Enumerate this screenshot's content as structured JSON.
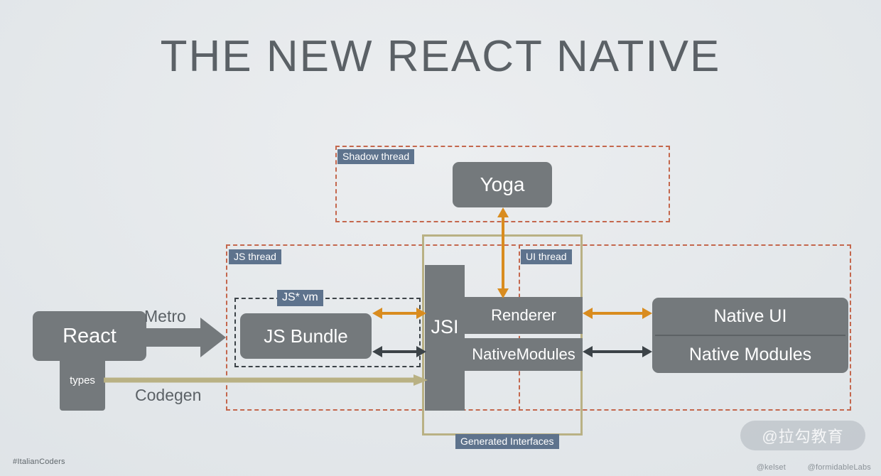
{
  "slide": {
    "title": "THE NEW REACT NATIVE",
    "background_color": "#e4e8eb",
    "node_color": "#74797c",
    "chip_color": "#5e738d",
    "region_color": "#c4674d",
    "olive_color": "#b9b184",
    "orange_arrow_color": "#d98c1f",
    "dark_arrow_color": "#3c4348"
  },
  "regions": [
    {
      "name": "shadow-thread",
      "label": "Shadow thread"
    },
    {
      "name": "js-thread",
      "label": "JS thread"
    },
    {
      "name": "ui-thread",
      "label": "UI thread"
    },
    {
      "name": "js-vm",
      "label": "JS* vm"
    },
    {
      "name": "generated-interfaces",
      "label": "Generated Interfaces"
    }
  ],
  "nodes": {
    "react": "React",
    "react_types": "types",
    "yoga": "Yoga",
    "js_bundle": "JS Bundle",
    "jsi": "JSI",
    "renderer": "Renderer",
    "native_modules_arm": "NativeModules",
    "native_ui": "Native UI",
    "native_modules": "Native Modules"
  },
  "connectors": {
    "metro": "Metro",
    "codegen": "Codegen"
  },
  "footer": {
    "hashtag": "#ItalianCoders",
    "watermark": "@拉勾教育",
    "credit_author": "@kelset",
    "credit_org": "@formidableLabs"
  }
}
